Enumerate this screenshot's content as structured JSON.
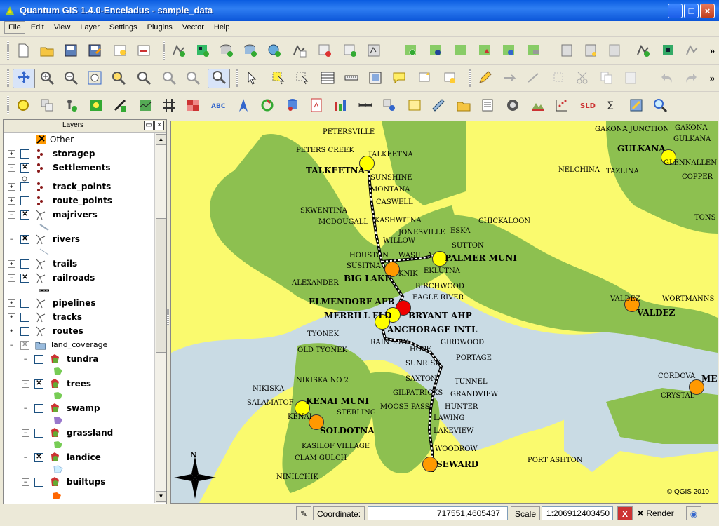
{
  "window": {
    "title": "Quantum GIS 1.4.0-Enceladus - sample_data"
  },
  "menu": [
    "File",
    "Edit",
    "View",
    "Layer",
    "Settings",
    "Plugins",
    "Vector",
    "Help"
  ],
  "layers_panel": {
    "title": "Layers",
    "items": [
      {
        "label": "Other",
        "checked": null
      },
      {
        "label": "storagep",
        "checked": false
      },
      {
        "label": "Settlements",
        "checked": true
      },
      {
        "label": "track_points",
        "checked": false
      },
      {
        "label": "route_points",
        "checked": false
      },
      {
        "label": "majrivers",
        "checked": true
      },
      {
        "label": "rivers",
        "checked": true
      },
      {
        "label": "trails",
        "checked": false
      },
      {
        "label": "railroads",
        "checked": true
      },
      {
        "label": "pipelines",
        "checked": false
      },
      {
        "label": "tracks",
        "checked": false
      },
      {
        "label": "routes",
        "checked": false
      },
      {
        "label": "land_coverage",
        "checked": true
      },
      {
        "label": "tundra",
        "checked": false
      },
      {
        "label": "trees",
        "checked": true
      },
      {
        "label": "swamp",
        "checked": false
      },
      {
        "label": "grassland",
        "checked": false
      },
      {
        "label": "landice",
        "checked": true
      },
      {
        "label": "builtups",
        "checked": false
      }
    ]
  },
  "map": {
    "places": [
      "PETERSVILLE",
      "PETERS CREEK",
      "TALKEETNA",
      "TALKEETNA",
      "SUNSHINE",
      "MONTANA",
      "CASWELL",
      "SKWENTINA",
      "MCDOUGALL",
      "KASHWITNA",
      "JONESVILLE",
      "ESKA",
      "CHICKALOON",
      "WILLOW",
      "SUTTON",
      "HOUSTON",
      "WASILLA",
      "PALMER MUNI",
      "SUSITNA",
      "KNIK",
      "EKLUTNA",
      "BIG LAKE",
      "ALEXANDER",
      "BIRCHWOOD",
      "ELMENDORF AFB",
      "EAGLE RIVER",
      "MERRILL FLD",
      "BRYANT AHP",
      "ANCHORAGE INTL",
      "TYONEK",
      "OLD TYONEK",
      "RAINBOW",
      "HOPE",
      "GIRDWOOD",
      "PORTAGE",
      "SUNRISE",
      "SAXTON",
      "TUNNEL",
      "NIKISKA",
      "NIKISKA NO 2",
      "KENAI MUNI",
      "GILPATRICKS",
      "GRANDVIEW",
      "SALAMATOF",
      "STERLING",
      "MOOSE PASS",
      "HUNTER",
      "KENAI",
      "SOLDOTNA",
      "LAWING",
      "LAKEVIEW",
      "KASILOF VILLAGE",
      "WOODROW",
      "CLAM GULCH",
      "SEWARD",
      "PORT ASHTON",
      "NINILCHIK",
      "GAKONA JUNCTION",
      "GAKONA",
      "GULKANA",
      "GULKANA",
      "GLENNALLEN",
      "COPPER",
      "NELCHINA",
      "TAZLINA",
      "TONS",
      "VALDEZ",
      "VALDEZ",
      "WORTMANNS",
      "CORDOVA",
      "CRYSTAL",
      "ME"
    ],
    "copyright": "© QGIS 2010",
    "north": "N"
  },
  "statusbar": {
    "coordinate_label": "Coordinate:",
    "coordinate_value": "717551,4605437",
    "scale_label": "Scale",
    "scale_value": "1:206912403450",
    "render_label": "Render"
  }
}
